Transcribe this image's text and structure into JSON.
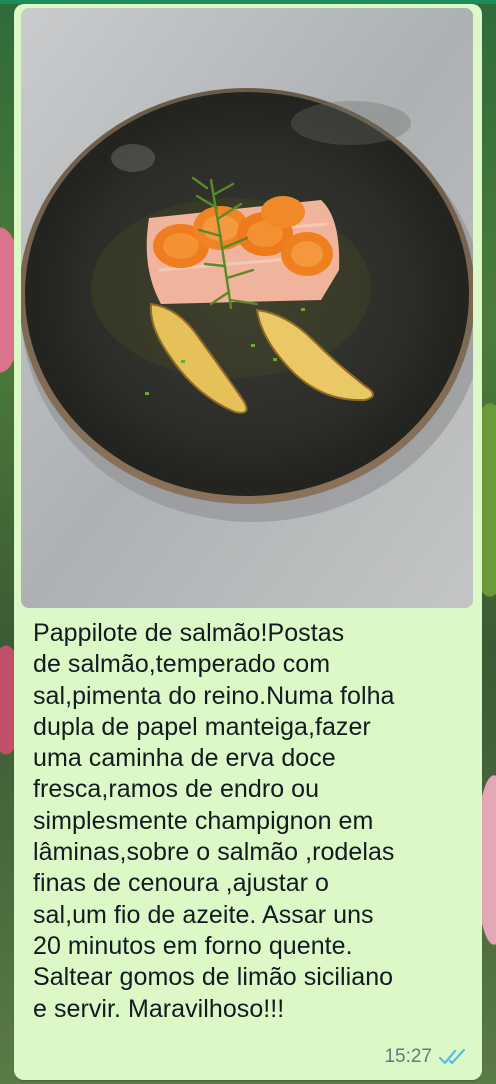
{
  "message": {
    "photo": {
      "icon": "food-photo",
      "colors": {
        "plate": "#2e2f2a",
        "carrot": "#f07a1e",
        "salmon": "#f2b39a",
        "potato": "#e8c35a",
        "dill": "#5e8a2a"
      }
    },
    "caption": "Pappilote de salmão!Postas\nde salmão,temperado com\nsal,pimenta do reino.Numa folha\ndupla de papel manteiga,fazer\numa caminha de erva doce\nfresca,ramos de endro ou\nsimplesmente champignon em\nlâminas,sobre o salmão ,rodelas\nfinas de cenoura ,ajustar o\nsal,um fio de azeite. Assar uns\n20 minutos em forno quente.\nSaltear gomos de limão siciliano\ne servir. Maravilhoso!!!",
    "time": "15:27",
    "status_icon": "double-check-read-icon",
    "bubble_color": "#dcf8c6",
    "tick_color": "#53bdeb"
  }
}
